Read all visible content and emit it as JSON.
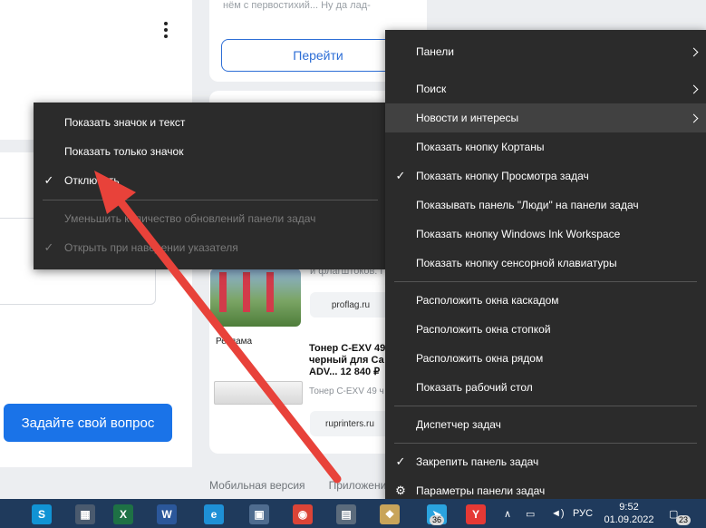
{
  "page": {
    "snippet_text": "нём с первостихий... Ну да лад-",
    "go_button": "Перейти",
    "ask_button": "Задайте свой вопрос",
    "ad_snippet": "и флагштоков. П",
    "ad_source_1": "proflag.ru",
    "ad_label": "Реклама",
    "product_title_1": "Тонер C-EXV 49",
    "product_title_2": "черный для Са",
    "product_title_3": "ADV... 12 840 ₽",
    "product_sub": "Тонер C-EXV 49 ч",
    "ad_source_2": "ruprinters.ru",
    "footer_mobile": "Мобильная версия",
    "footer_apps": "Приложения"
  },
  "submenu": {
    "items": [
      {
        "label": "Показать значок и текст",
        "checked": false,
        "disabled": false
      },
      {
        "label": "Показать только значок",
        "checked": false,
        "disabled": false
      },
      {
        "label": "Отключить",
        "checked": true,
        "disabled": false
      },
      {
        "label": "Уменьшить количество обновлений панели задач",
        "checked": false,
        "disabled": true
      },
      {
        "label": "Открыть при наведении указателя",
        "checked": true,
        "disabled": true
      }
    ]
  },
  "menu": {
    "items": [
      {
        "label": "Панели",
        "submenu": true
      },
      {
        "label": "Поиск",
        "submenu": true
      },
      {
        "label": "Новости и интересы",
        "submenu": true,
        "highlighted": true
      },
      {
        "label": "Показать кнопку Кортаны"
      },
      {
        "label": "Показать кнопку Просмотра задач",
        "checked": true
      },
      {
        "label": "Показывать панель \"Люди\" на панели задач"
      },
      {
        "label": "Показать кнопку Windows Ink Workspace"
      },
      {
        "label": "Показать кнопку сенсорной клавиатуры"
      },
      {
        "label": "Расположить окна каскадом"
      },
      {
        "label": "Расположить окна стопкой"
      },
      {
        "label": "Расположить окна рядом"
      },
      {
        "label": "Показать рабочий стол"
      },
      {
        "label": "Диспетчер задач"
      },
      {
        "label": "Закрепить панель задач",
        "checked": true
      },
      {
        "label": "Параметры панели задач",
        "gear": true
      }
    ]
  },
  "taskbar": {
    "apps": [
      {
        "name": "skype-icon",
        "glyph": "S",
        "color": "#1193d4"
      },
      {
        "name": "calculator-icon",
        "glyph": "▦",
        "color": "#4a5a6e"
      },
      {
        "name": "excel-icon",
        "glyph": "X",
        "color": "#1e7145"
      },
      {
        "name": "word-icon",
        "glyph": "W",
        "color": "#2b579a"
      },
      {
        "name": "edge-icon",
        "glyph": "e",
        "color": "#1e90d6"
      },
      {
        "name": "remote-desktop-icon",
        "glyph": "▣",
        "color": "#4f6c8f"
      },
      {
        "name": "chrome-icon",
        "glyph": "◉",
        "color": "#db4437"
      },
      {
        "name": "printer-icon",
        "glyph": "▤",
        "color": "#5b6b7c"
      },
      {
        "name": "folder-icon",
        "glyph": "❖",
        "color": "#c8a45a"
      },
      {
        "name": "telegram-icon",
        "glyph": "➤",
        "color": "#2aa3df"
      },
      {
        "name": "yandex-browser-icon",
        "glyph": "Y",
        "color": "#e53935"
      }
    ],
    "telegram_badge": "36",
    "language": "РУС",
    "time": "9:52",
    "date": "01.09.2022",
    "notifications_badge": "23"
  }
}
